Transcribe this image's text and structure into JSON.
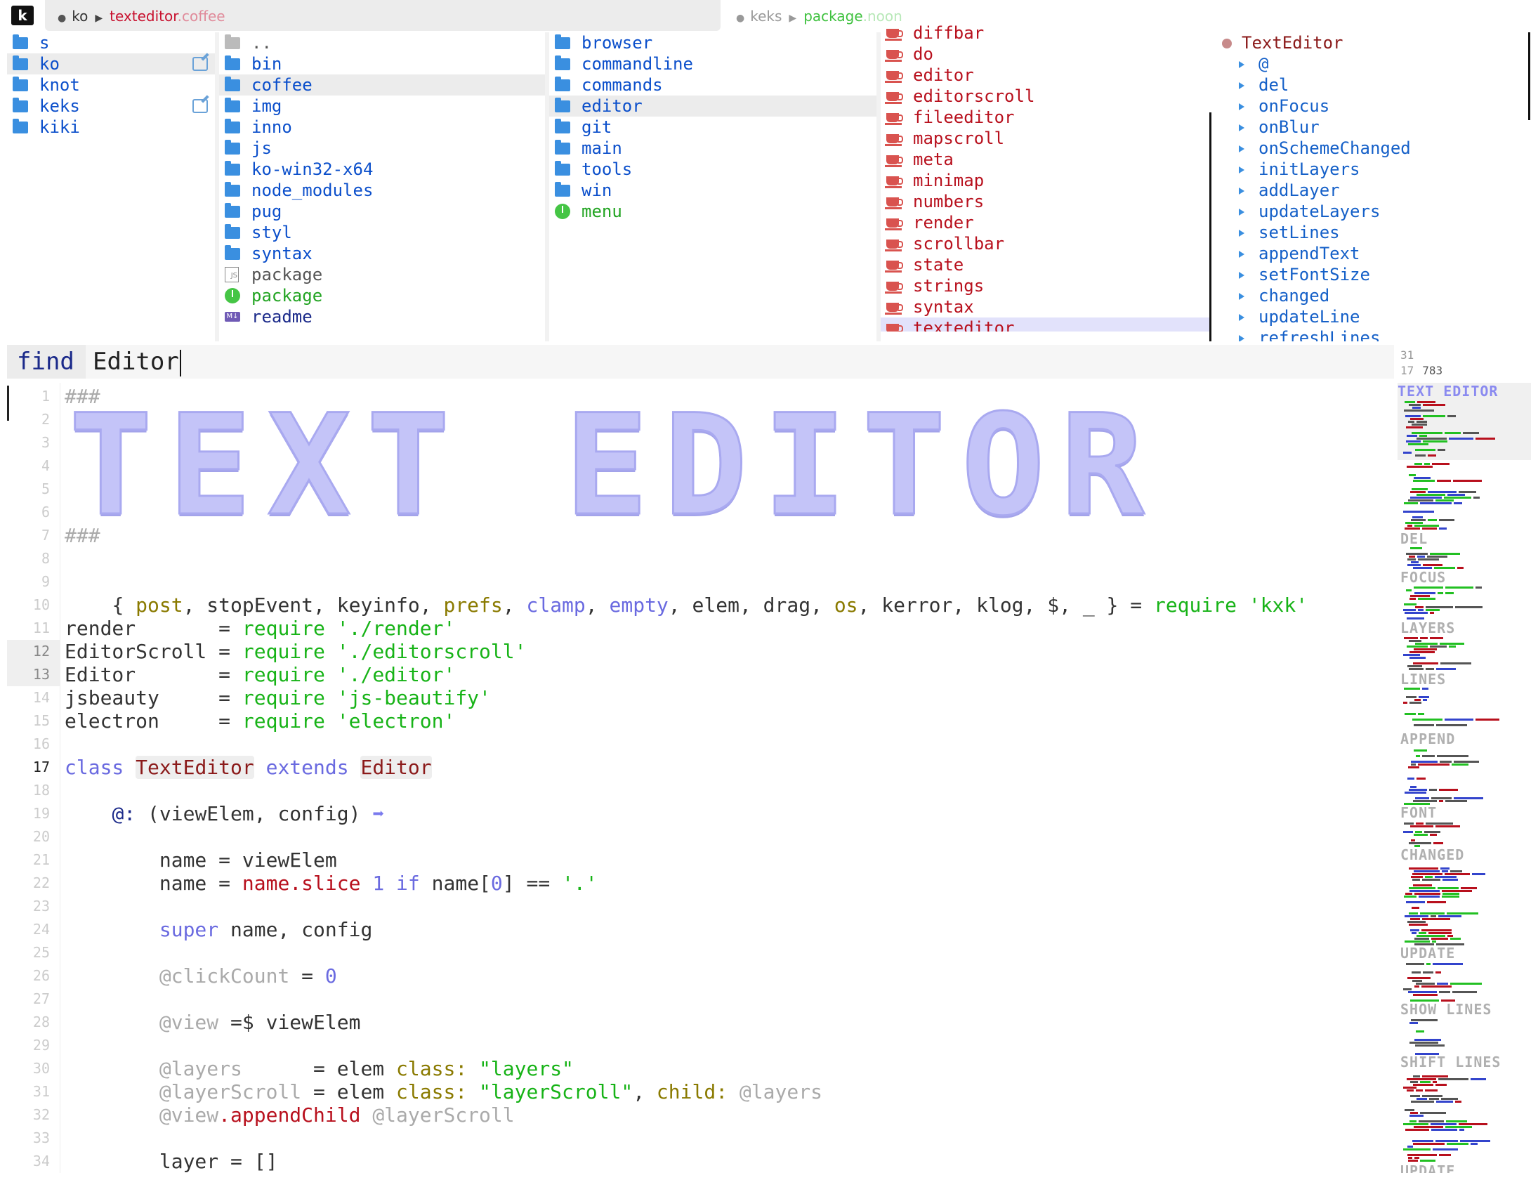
{
  "titlebar": {
    "logo": "k",
    "tab1": {
      "project": "ko",
      "file": "texteditor",
      "ext": ".coffee"
    },
    "tab2": {
      "project": "keks",
      "file": "package",
      "ext": ".noon"
    }
  },
  "browser": {
    "col1": [
      {
        "label": "s"
      },
      {
        "label": "ko",
        "selected": true,
        "edit": true
      },
      {
        "label": "knot"
      },
      {
        "label": "keks",
        "edit": true
      },
      {
        "label": "kiki"
      }
    ],
    "col2": [
      {
        "label": "..",
        "icon": "folder-gray"
      },
      {
        "label": "bin",
        "icon": "folder"
      },
      {
        "label": "coffee",
        "icon": "folder",
        "selected": true
      },
      {
        "label": "img",
        "icon": "folder"
      },
      {
        "label": "inno",
        "icon": "folder"
      },
      {
        "label": "js",
        "icon": "folder"
      },
      {
        "label": "ko-win32-x64",
        "icon": "folder"
      },
      {
        "label": "node_modules",
        "icon": "folder"
      },
      {
        "label": "pug",
        "icon": "folder"
      },
      {
        "label": "styl",
        "icon": "folder"
      },
      {
        "label": "syntax",
        "icon": "folder"
      },
      {
        "label": "package",
        "icon": "js"
      },
      {
        "label": "package",
        "icon": "noon"
      },
      {
        "label": "readme",
        "icon": "md"
      }
    ],
    "col3": [
      {
        "label": "browser"
      },
      {
        "label": "commandline"
      },
      {
        "label": "commands"
      },
      {
        "label": "editor",
        "selected": true
      },
      {
        "label": "git"
      },
      {
        "label": "main"
      },
      {
        "label": "tools"
      },
      {
        "label": "win"
      },
      {
        "label": "menu",
        "icon": "noon"
      }
    ],
    "col4": [
      "diffbar",
      "do",
      "editor",
      "editorscroll",
      "fileeditor",
      "mapscroll",
      "meta",
      "minimap",
      "numbers",
      "render",
      "scrollbar",
      "state",
      "strings",
      "syntax",
      "texteditor"
    ],
    "col5": {
      "class_name": "TextEditor",
      "items": [
        "@",
        "del",
        "onFocus",
        "onBlur",
        "onSchemeChanged",
        "initLayers",
        "addLayer",
        "updateLayers",
        "setLines",
        "appendText",
        "setFontSize",
        "changed",
        "updateLine",
        "refreshLines"
      ]
    }
  },
  "findbar": {
    "label": "find",
    "value": "Editor"
  },
  "position": {
    "line": "31",
    "col_line": "17",
    "col": "783"
  },
  "banner": {
    "text": "TEXT EDITOR"
  },
  "code": {
    "hash1": "###",
    "hash2": "###",
    "line9": [
      "{ ",
      "post",
      ", stopEvent, keyinfo, ",
      "prefs",
      ", ",
      "clamp",
      ", ",
      "empty",
      ", elem, drag, ",
      "os",
      ", kerror, klog, $, _ } = ",
      "require",
      " ",
      "'kxk'"
    ],
    "line11": [
      "render       = ",
      "require",
      " ",
      "'./render'"
    ],
    "line12": [
      "EditorScroll = ",
      "require",
      " ",
      "'./editorscroll'"
    ],
    "line13": [
      "Editor       = ",
      "require",
      " ",
      "'./editor'"
    ],
    "line14": [
      "jsbeauty     = ",
      "require",
      " ",
      "'js-beautify'"
    ],
    "line15": [
      "electron     = ",
      "require",
      " ",
      "'electron'"
    ],
    "line17": [
      "class",
      " ",
      "TextEditor",
      " ",
      "extends",
      " ",
      "Editor"
    ],
    "line19": [
      "    ",
      "@:",
      " (viewElem, config) ",
      "➡"
    ],
    "line21": "        name = viewElem",
    "line22": [
      "        name = ",
      "name",
      ".slice ",
      "1",
      " ",
      "if",
      " name[",
      "0",
      "] == ",
      "'.'"
    ],
    "line24": [
      "        ",
      "super",
      " name, config"
    ],
    "line26": [
      "        ",
      "@clickCount",
      " = ",
      "0"
    ],
    "line28": [
      "        ",
      "@view",
      " =$ viewElem"
    ],
    "line30": [
      "        ",
      "@layers",
      "      = elem ",
      "class:",
      " ",
      "\"layers\""
    ],
    "line31": [
      "        ",
      "@layerScroll",
      " = elem ",
      "class:",
      " ",
      "\"layerScroll\"",
      ", ",
      "child:",
      " ",
      "@layers"
    ],
    "line32": [
      "        ",
      "@view",
      ".appendChild ",
      "@layerScroll"
    ],
    "line34": "        layer = []"
  },
  "minimap": {
    "headings": [
      "TEXT EDITOR",
      "DEL",
      "FOCUS",
      "LAYERS",
      "LINES",
      "APPEND",
      "FONT",
      "CHANGED",
      "UPDATE",
      "SHOW LINES",
      "SHIFT LINES",
      "UPDATE"
    ],
    "colors": {
      "red": "#b8101d",
      "green": "#22c022",
      "blue": "#3344cc",
      "gray": "#555555"
    }
  }
}
